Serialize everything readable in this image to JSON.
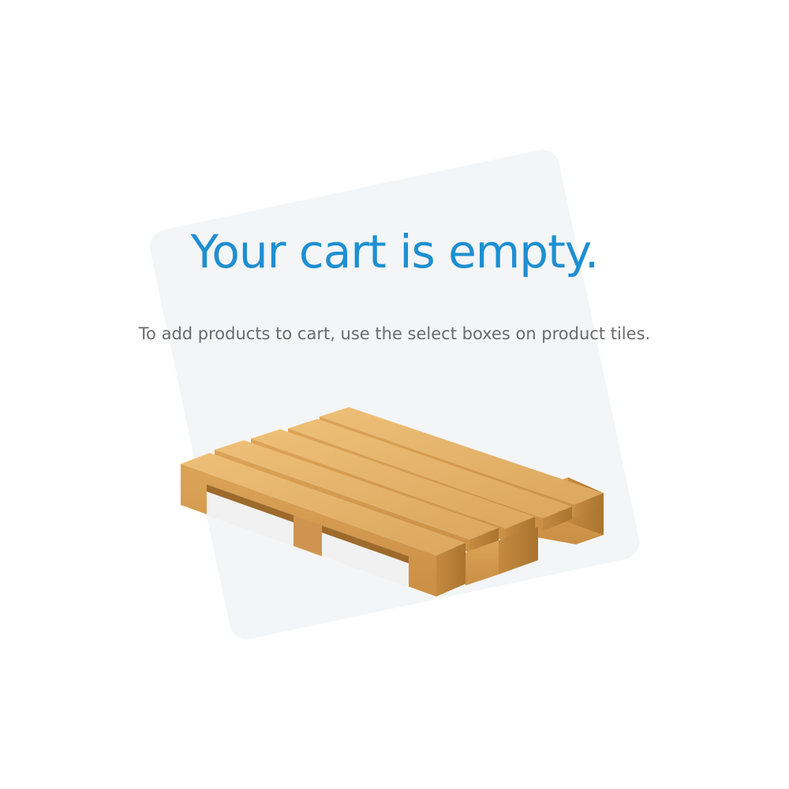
{
  "empty_cart": {
    "title": "Your cart is empty.",
    "message": "To add products to cart, use the select boxes on product tiles.",
    "illustration_icon": "wooden-pallet-icon"
  },
  "colors": {
    "title": "#1e8fd1",
    "message": "#6b6b6b",
    "backdrop": "#f4f5f6",
    "wood_top": "#e6b46a",
    "wood_front": "#d79e52",
    "wood_side": "#b97f39"
  }
}
